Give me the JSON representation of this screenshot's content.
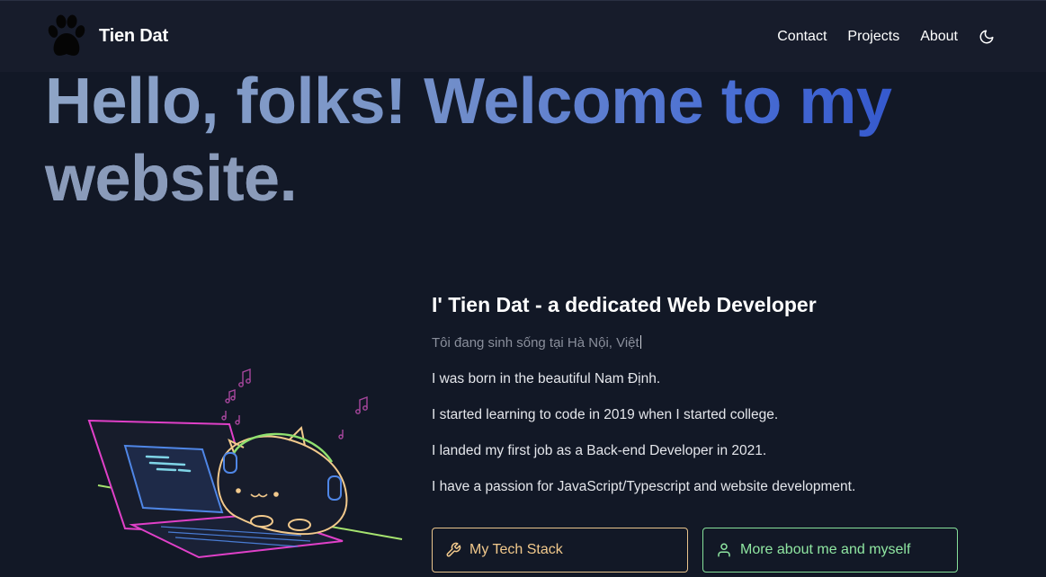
{
  "header": {
    "brand_name": "Tien Dat",
    "logo_icon": "paw-icon",
    "nav": [
      {
        "label": "Contact"
      },
      {
        "label": "Projects"
      },
      {
        "label": "About"
      }
    ],
    "theme_icon": "moon-icon"
  },
  "hero": {
    "line1": "Hello, folks! Welcome to my",
    "line2": "website."
  },
  "intro": {
    "heading": "I' Tien Dat - a dedicated Web Developer",
    "typing_text": "Tôi đang sinh sống tại  Hà Nội, Việt",
    "bio": [
      "I was born in the beautiful Nam Định.",
      "I started learning to code in 2019 when I started college.",
      "I landed my first job as a Back-end Developer in 2021.",
      "I have a passion for JavaScript/Typescript and website development."
    ]
  },
  "actions": {
    "tech_stack_label": "My Tech Stack",
    "tech_stack_icon": "wrench-icon",
    "more_label": "More about me and myself",
    "more_icon": "user-icon"
  },
  "colors": {
    "background": "#121826",
    "header": "#171c2b",
    "tech_button": "#e9c48c",
    "more_button": "#86e09a",
    "hero_gradient_end": "#2649c9"
  }
}
